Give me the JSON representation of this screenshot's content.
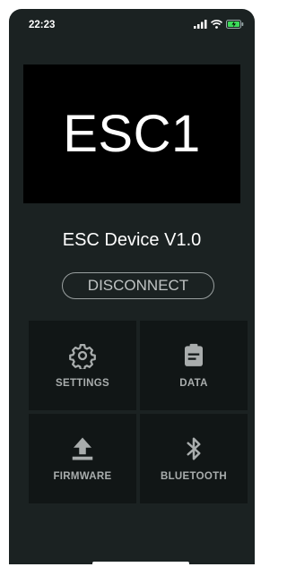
{
  "status_bar": {
    "time": "22:23",
    "icons": [
      "cellular-signal-icon",
      "wifi-icon",
      "battery-charging-icon"
    ]
  },
  "hero": {
    "title": "ESC1"
  },
  "device": {
    "name": "ESC Device V1.0"
  },
  "actions": {
    "disconnect_label": "DISCONNECT"
  },
  "tiles": [
    {
      "label": "SETTINGS",
      "icon": "gear-icon"
    },
    {
      "label": "DATA",
      "icon": "clipboard-icon"
    },
    {
      "label": "FIRMWARE",
      "icon": "upload-icon"
    },
    {
      "label": "BLUETOOTH",
      "icon": "bluetooth-icon"
    }
  ],
  "colors": {
    "background": "#1b2222",
    "hero_background": "#000000",
    "tile_background": "#111616",
    "icon": "#a9adad",
    "battery": "#3ddc5a"
  }
}
